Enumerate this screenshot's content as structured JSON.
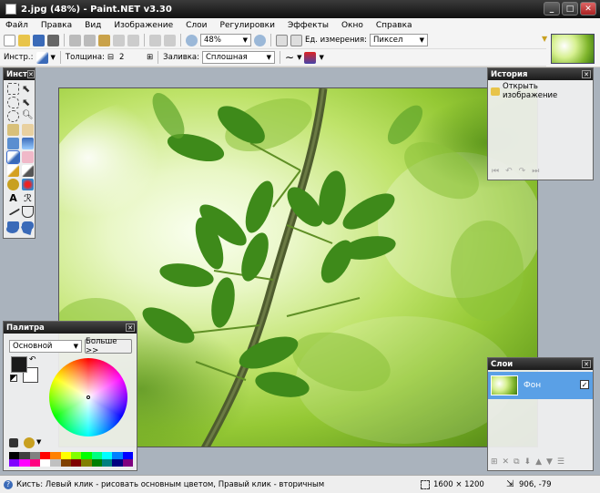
{
  "window": {
    "title": "2.jpg (48%) - Paint.NET v3.30",
    "minimize": "_",
    "maximize": "□",
    "close": "✕"
  },
  "menu": [
    "Файл",
    "Правка",
    "Вид",
    "Изображение",
    "Слои",
    "Регулировки",
    "Эффекты",
    "Окно",
    "Справка"
  ],
  "toolbar": {
    "zoom_value": "48%",
    "units_label": "Ед. измерения:",
    "units_value": "Пиксел"
  },
  "tool_options": {
    "tool_label": "Инстр.:",
    "thickness_label": "Толщина:",
    "thickness_value": "2",
    "thickness_minus": "⊟",
    "thickness_plus": "⊞",
    "fill_label": "Заливка:",
    "fill_value": "Сплошная"
  },
  "tools_panel": {
    "title": "Инст",
    "text_tool": "A",
    "relief_tool": "ℛ"
  },
  "history_panel": {
    "title": "История",
    "items": [
      "Открыть изображение"
    ]
  },
  "palette_panel": {
    "title": "Палитра",
    "mode_value": "Основной",
    "more_button": "Больше >>"
  },
  "layers_panel": {
    "title": "Слои",
    "layers": [
      {
        "name": "Фон",
        "visible": true,
        "selected": true
      }
    ]
  },
  "status": {
    "hint": "Кисть: Левый клик - рисовать основным цветом, Правый клик - вторичным",
    "image_size": "1600 × 1200",
    "cursor_pos": "906, -79"
  },
  "colors": {
    "primary": "#1a1a1a",
    "secondary": "#ffffff",
    "selection": "#5aa0e6"
  },
  "palette_swatches": [
    "#000000",
    "#404040",
    "#808080",
    "#ff0000",
    "#ff8000",
    "#ffff00",
    "#80ff00",
    "#00ff00",
    "#00ff80",
    "#00ffff",
    "#0080ff",
    "#0000ff",
    "#8000ff",
    "#ff00ff",
    "#ff0080",
    "#ffffff",
    "#c0c0c0",
    "#804000",
    "#800000",
    "#808000",
    "#008000",
    "#008080",
    "#000080",
    "#800080"
  ]
}
